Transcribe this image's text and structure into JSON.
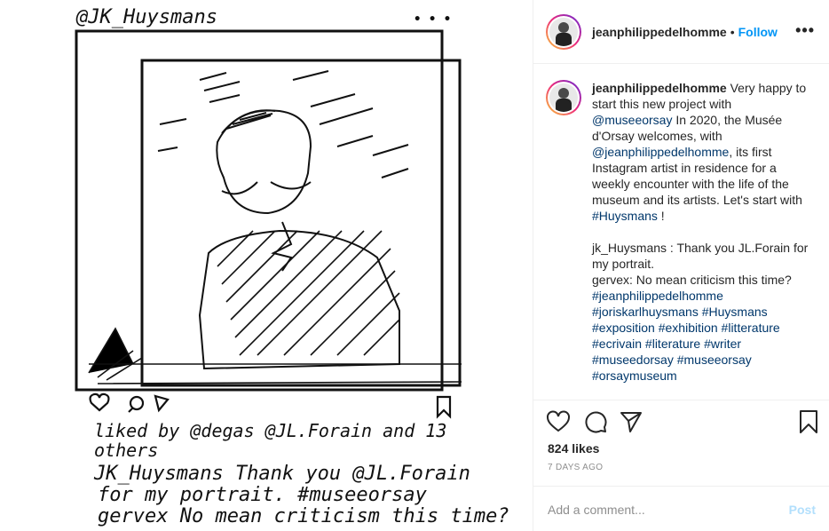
{
  "image": {
    "handle": "@JK_Huysmans",
    "liked_by": "liked by @degas @JL.Forain and 13",
    "liked_by_2": "others",
    "caption_1": "JK_Huysmans Thank you @JL.Forain",
    "caption_2": "for my portrait. #museeorsay",
    "caption_3": "gervex No mean criticism this time?",
    "dots": "• • •"
  },
  "header": {
    "username": "jeanphilippedelhomme",
    "separator": "•",
    "follow_label": "Follow",
    "more_label": "•••"
  },
  "caption": {
    "username": "jeanphilippedelhomme",
    "t1": " Very happy to start this new project with ",
    "m1": "@museeorsay",
    "t2": " In 2020, the Musée d'Orsay welcomes, with ",
    "m2": "@jeanphilippedelhomme",
    "t3": ", its first Instagram artist in residence for a weekly encounter with the life of the museum and its artists. Let's start with ",
    "h1": "#Huysmans",
    "t4": " !",
    "line_a": "jk_Huysmans : Thank you JL.Forain for my portrait.",
    "line_b": "gervex: No mean criticism this time?",
    "tags": [
      "#jeanphilippedelhomme",
      "#joriskarlhuysmans",
      "#Huysmans",
      "#exposition",
      "#exhibition",
      "#litterature",
      "#ecrivain",
      "#literature",
      "#writer",
      "#museedorsay",
      "#museeorsay",
      "#orsaymuseum"
    ]
  },
  "actions": {
    "icons": [
      "heart-icon",
      "comment-icon",
      "share-icon",
      "bookmark-icon"
    ],
    "likes": "824 likes",
    "time_ago": "7 DAYS AGO",
    "comment_placeholder": "Add a comment...",
    "post_label": "Post"
  },
  "colors": {
    "accent": "#0095f6",
    "link": "#00376b",
    "muted": "#8e8e8e",
    "post_disabled": "#b2dffc"
  }
}
